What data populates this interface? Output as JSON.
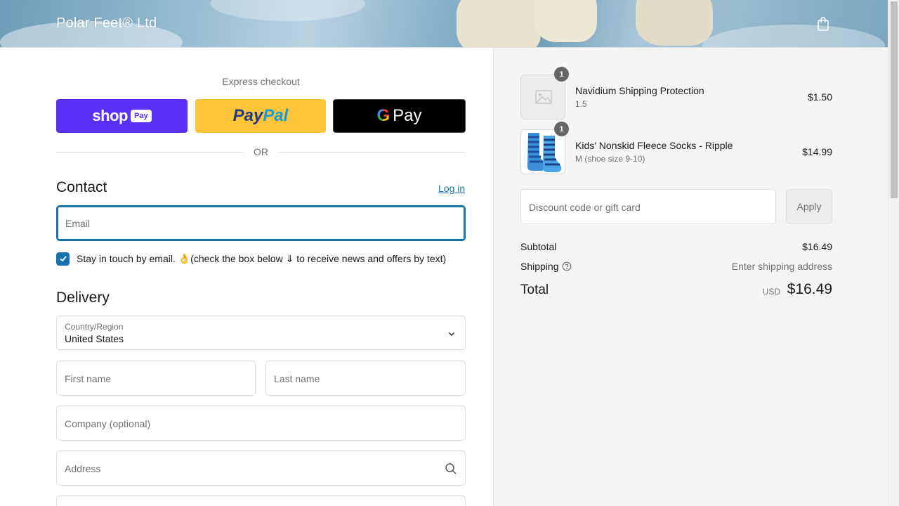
{
  "header": {
    "brand": "Polar Feet® Ltd",
    "cart_icon": "shopping-bag-icon"
  },
  "express": {
    "title": "Express checkout",
    "shop_pay": {
      "word": "shop",
      "badge": "Pay"
    },
    "paypal": {
      "part1": "Pay",
      "part2": "Pal"
    },
    "google_pay": {
      "g": "G",
      "word": "Pay"
    },
    "or": "OR"
  },
  "contact": {
    "title": "Contact",
    "login_link": "Log in",
    "email_placeholder": "Email",
    "newsletter_label": "Stay in touch by email. 👌(check the box below ⇓ to receive news and offers by text)",
    "newsletter_checked": true
  },
  "delivery": {
    "title": "Delivery",
    "country_label": "Country/Region",
    "country_value": "United States",
    "first_name_placeholder": "First name",
    "last_name_placeholder": "Last name",
    "company_placeholder": "Company (optional)",
    "address_placeholder": "Address"
  },
  "summary": {
    "items": [
      {
        "name": "Navidium Shipping Protection",
        "variant": "1.5",
        "price": "$1.50",
        "quantity": "1",
        "image": "image-placeholder-icon"
      },
      {
        "name": "Kids' Nonskid Fleece Socks - Ripple",
        "variant": "M (shoe size 9-10)",
        "price": "$14.99",
        "quantity": "1",
        "image": "sock-image"
      }
    ],
    "discount_placeholder": "Discount code or gift card",
    "apply_label": "Apply",
    "subtotal_label": "Subtotal",
    "subtotal_value": "$16.49",
    "shipping_label": "Shipping",
    "shipping_value": "Enter shipping address",
    "total_label": "Total",
    "total_currency": "USD",
    "total_value": "$16.49"
  },
  "colors": {
    "accent": "#1773b0",
    "shop_pay": "#5a31f4",
    "paypal": "#ffc439",
    "google_pay": "#000000",
    "sidebar_bg": "#f5f5f5"
  }
}
